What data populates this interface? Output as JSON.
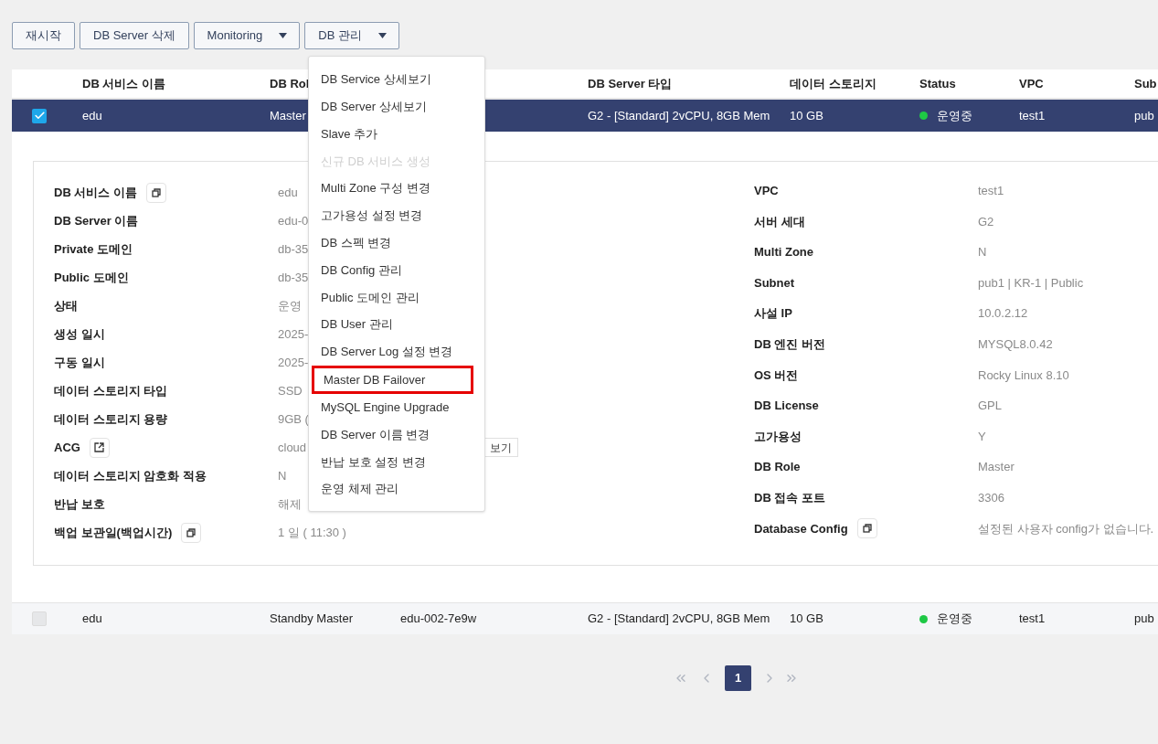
{
  "toolbar": [
    {
      "label": "재시작",
      "dropdown": false
    },
    {
      "label": "DB Server 삭제",
      "dropdown": false
    },
    {
      "label": "Monitoring",
      "dropdown": true
    },
    {
      "label": "DB 관리",
      "dropdown": true
    }
  ],
  "table": {
    "columns": [
      "DB 서비스 이름",
      "DB Rol",
      "DB Server 타입",
      "데이터 스토리지",
      "Status",
      "VPC",
      "Sub"
    ],
    "rows": [
      {
        "selected": true,
        "service_name": "edu",
        "role": "Master",
        "server_type": "G2 - [Standard] 2vCPU, 8GB Mem",
        "storage": "10 GB",
        "status": "운영중",
        "color": "#1ec845",
        "vpc": "test1",
        "subnet": "pub"
      },
      {
        "selected": false,
        "service_name": "edu",
        "role": "Standby Master",
        "server_name": "edu-002-7e9w",
        "server_type": "G2 - [Standard] 2vCPU, 8GB Mem",
        "storage": "10 GB",
        "status": "운영중",
        "color": "#1ec845",
        "vpc": "test1",
        "subnet": "pub"
      }
    ]
  },
  "details": {
    "left": [
      {
        "label": "DB 서비스 이름",
        "kind": "copy",
        "value": "edu"
      },
      {
        "label": "DB Server 이름",
        "value": "edu-0"
      },
      {
        "label": "Private 도메인",
        "value": "db-35"
      },
      {
        "label": "Public 도메인",
        "value": "db-35"
      },
      {
        "label": "상태",
        "value": "운영"
      },
      {
        "label": "생성 일시",
        "value": "2025-"
      },
      {
        "label": "구동 일시",
        "value": "2025-"
      },
      {
        "label": "데이터 스토리지 타입",
        "value": "SSD"
      },
      {
        "label": "데이터 스토리지 용량",
        "value": "9GB ("
      },
      {
        "label": "ACG",
        "kind": "external",
        "value": "cloud",
        "button": "보기"
      },
      {
        "label": "데이터 스토리지 암호화 적용",
        "value": "N"
      },
      {
        "label": "반납 보호",
        "value": "해제"
      },
      {
        "label": "백업 보관일(백업시간)",
        "kind": "copy",
        "value": "1 일 ( 11:30 )"
      }
    ],
    "right": [
      {
        "label": "VPC",
        "value": "test1"
      },
      {
        "label": "서버 세대",
        "value": "G2"
      },
      {
        "label": "Multi Zone",
        "value": "N"
      },
      {
        "label": "Subnet",
        "value": "pub1 | KR-1 | Public"
      },
      {
        "label": "사설 IP",
        "value": "10.0.2.12"
      },
      {
        "label": "DB 엔진 버전",
        "value": "MYSQL8.0.42"
      },
      {
        "label": "OS 버전",
        "value": "Rocky Linux 8.10"
      },
      {
        "label": "DB License",
        "value": "GPL"
      },
      {
        "label": "고가용성",
        "value": "Y"
      },
      {
        "label": "DB Role",
        "value": "Master"
      },
      {
        "label": "DB 접속 포트",
        "value": "3306"
      },
      {
        "label": "Database Config",
        "kind": "copy",
        "value": "설정된 사용자 config가 없습니다."
      }
    ]
  },
  "menu": [
    {
      "label": "DB Service 상세보기",
      "disabled": false,
      "highlighted": false
    },
    {
      "label": "DB Server 상세보기",
      "disabled": false,
      "highlighted": false
    },
    {
      "label": "Slave 추가",
      "disabled": false,
      "highlighted": false
    },
    {
      "label": "신규 DB 서비스 생성",
      "disabled": true,
      "highlighted": false
    },
    {
      "label": "Multi Zone 구성 변경",
      "disabled": false,
      "highlighted": false
    },
    {
      "label": "고가용성 설정 변경",
      "disabled": false,
      "highlighted": false
    },
    {
      "label": "DB 스펙 변경",
      "disabled": false,
      "highlighted": false
    },
    {
      "label": "DB Config 관리",
      "disabled": false,
      "highlighted": false
    },
    {
      "label": "Public 도메인 관리",
      "disabled": false,
      "highlighted": false
    },
    {
      "label": "DB User 관리",
      "disabled": false,
      "highlighted": false
    },
    {
      "label": "DB Server Log 설정 변경",
      "disabled": false,
      "highlighted": false
    },
    {
      "label": "Master DB Failover",
      "disabled": false,
      "highlighted": true
    },
    {
      "label": "MySQL Engine Upgrade",
      "disabled": false,
      "highlighted": false
    },
    {
      "label": "DB Server 이름 변경",
      "disabled": false,
      "highlighted": false
    },
    {
      "label": "반납 보호 설정 변경",
      "disabled": false,
      "highlighted": false
    },
    {
      "label": "운영 체제 관리",
      "disabled": false,
      "highlighted": false
    }
  ],
  "pagination": {
    "pages": [
      {
        "label": "1",
        "selected": true
      }
    ]
  }
}
